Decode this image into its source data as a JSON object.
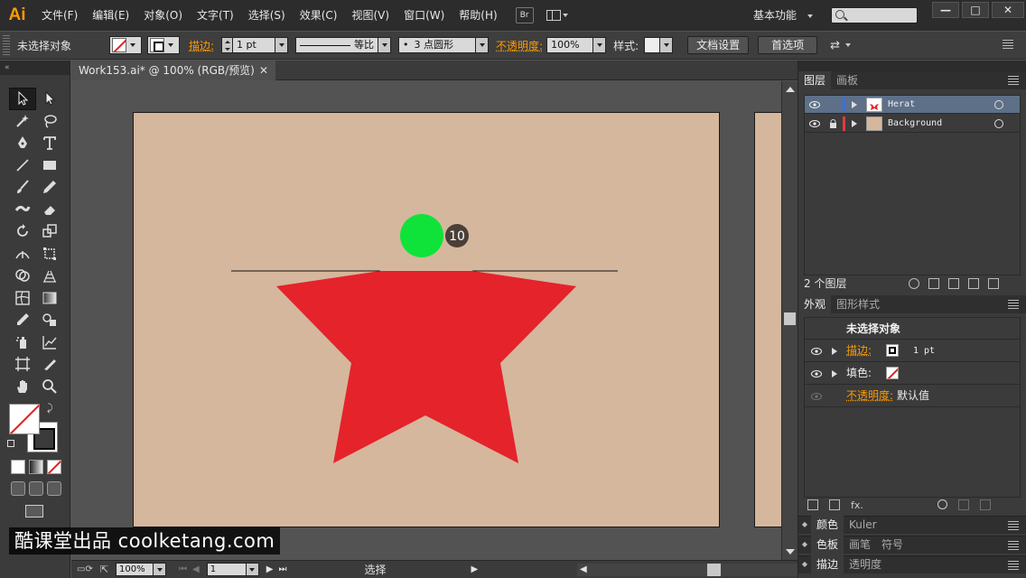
{
  "menubar": {
    "app_logo": "Ai",
    "items": [
      "文件(F)",
      "编辑(E)",
      "对象(O)",
      "文字(T)",
      "选择(S)",
      "效果(C)",
      "视图(V)",
      "窗口(W)",
      "帮助(H)"
    ],
    "bridge_label": "Br",
    "workspace_label": "基本功能",
    "window_buttons": [
      "—",
      "□",
      "✕"
    ]
  },
  "control": {
    "selection_label": "未选择对象",
    "stroke_label": "描边:",
    "stroke_weight": "1 pt",
    "stroke_profile": "等比",
    "brush_label": "3 点圆形",
    "opacity_label": "不透明度:",
    "opacity_value": "100%",
    "style_label": "样式:",
    "doc_setup_button": "文档设置",
    "preferences_button": "首选项"
  },
  "document": {
    "tab_title": "Work153.ai* @ 100% (RGB/预览)",
    "tab_close": "✕",
    "status_zoom": "100%",
    "status_page": "1",
    "status_tool": "选择"
  },
  "artwork": {
    "step_badge": "10",
    "star_color": "#e4232b",
    "circle_color": "#0fe33a",
    "artboard_color": "#d5b79d"
  },
  "layers_panel": {
    "tabs": [
      "图层",
      "画板"
    ],
    "layers": [
      {
        "name": "Herat",
        "color": "#3b6fe0",
        "selected": true,
        "locked": false
      },
      {
        "name": "Background",
        "color": "#e03b3b",
        "selected": false,
        "locked": true
      }
    ],
    "footer_count": "2 个图层"
  },
  "appearance_panel": {
    "tabs": [
      "外观",
      "图形样式"
    ],
    "title": "未选择对象",
    "rows": {
      "stroke_label": "描边:",
      "stroke_value": "1 pt",
      "fill_label": "填色:",
      "opacity_label": "不透明度:",
      "opacity_value": "默认值"
    },
    "fx_label": "fx."
  },
  "collapsed_panels": [
    [
      "颜色",
      "Kuler"
    ],
    [
      "色板",
      "画笔",
      "符号"
    ],
    [
      "描边",
      "透明度"
    ]
  ],
  "watermark": "酷课堂出品 coolketang.com"
}
